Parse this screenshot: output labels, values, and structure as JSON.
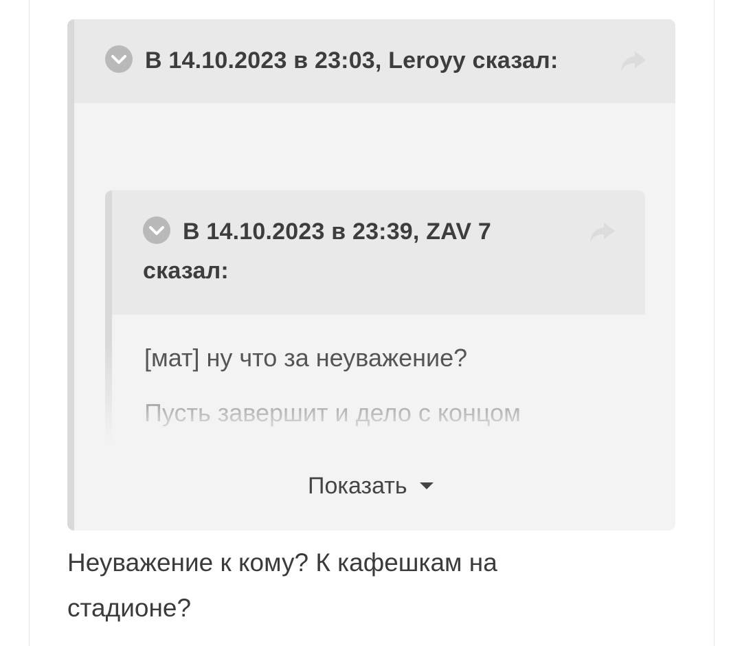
{
  "outer_quote": {
    "header": "В 14.10.2023 в 23:03, Leroyy сказал:"
  },
  "inner_quote": {
    "header_line1": "В 14.10.2023 в 23:39, ZAV 7",
    "header_line2": "сказал:",
    "lines": [
      "[мат] ну что за неуважение?",
      "Пусть завершит и дело с концом"
    ]
  },
  "show_more_label": "Показать",
  "reply": {
    "line1": "Неуважение к кому? К кафешкам на",
    "line2": "стадионе?"
  },
  "icons": {
    "expand": "chevron-down-icon",
    "share": "share-arrow-icon",
    "show_more": "caret-down-icon"
  },
  "colors": {
    "quote_bg": "#f3f3f3",
    "quote_header_bg": "#e9e9e9",
    "quote_bar": "#d9d9d9"
  }
}
